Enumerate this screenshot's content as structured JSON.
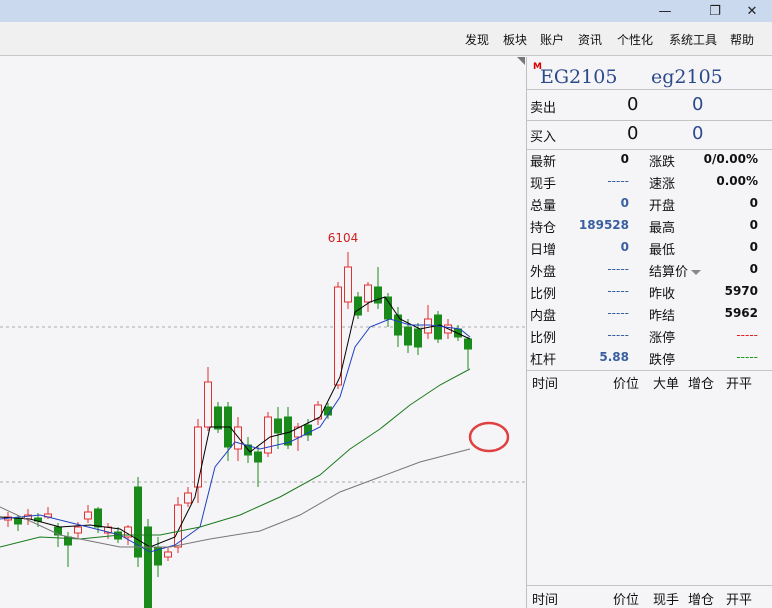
{
  "window": {
    "minimize_glyph": "—",
    "restore_glyph": "❐",
    "close_glyph": "✕"
  },
  "menu": [
    "发现",
    "板块",
    "账户",
    "资讯",
    "个性化",
    "系统工具",
    "帮助"
  ],
  "contract": {
    "badge": "M",
    "code_upper": "EG2105",
    "code_lower": "eg2105"
  },
  "orderbook": {
    "sell": {
      "label": "卖出",
      "price": "0",
      "volume": "0"
    },
    "buy": {
      "label": "买入",
      "price": "0",
      "volume": "0"
    }
  },
  "quote_left": [
    {
      "label": "最新",
      "value": "0",
      "style": "black"
    },
    {
      "label": "现手",
      "value": "-----",
      "style": "dash-blue"
    },
    {
      "label": "总量",
      "value": "0",
      "style": "blue"
    },
    {
      "label": "持仓",
      "value": "189528",
      "style": "blue"
    },
    {
      "label": "日增",
      "value": "0",
      "style": "blue"
    },
    {
      "label": "外盘",
      "value": "-----",
      "style": "dash-blue"
    },
    {
      "label": "比例",
      "value": "-----",
      "style": "dash-blue"
    },
    {
      "label": "内盘",
      "value": "-----",
      "style": "dash-blue"
    },
    {
      "label": "比例",
      "value": "-----",
      "style": "dash-blue"
    },
    {
      "label": "杠杆",
      "value": "5.88",
      "style": "blue"
    }
  ],
  "quote_right": [
    {
      "label": "涨跌",
      "value": "0/0.00%",
      "style": "black"
    },
    {
      "label": "速涨",
      "value": "0.00%",
      "style": "black"
    },
    {
      "label": "开盘",
      "value": "0",
      "style": "black"
    },
    {
      "label": "最高",
      "value": "0",
      "style": "black"
    },
    {
      "label": "最低",
      "value": "0",
      "style": "black"
    },
    {
      "label": "结算价",
      "value": "0",
      "style": "black"
    },
    {
      "label": "昨收",
      "value": "5970",
      "style": "black"
    },
    {
      "label": "昨结",
      "value": "5962",
      "style": "black"
    },
    {
      "label": "涨停",
      "value": "-----",
      "style": "dash-red"
    },
    {
      "label": "跌停",
      "value": "-----",
      "style": "dash-green"
    }
  ],
  "trade_table_headers": [
    "时间",
    "价位",
    "大单",
    "增仓",
    "开平"
  ],
  "tick_table_headers": [
    "时间",
    "价位",
    "现手",
    "增仓",
    "开平"
  ],
  "chart": {
    "peak_label": "6104",
    "colors": {
      "up": "#e03030",
      "down": "#1a8a1a",
      "ma5": "#000000",
      "ma10": "#2040c0",
      "ma20": "#1a7a1a",
      "ma60": "#777777",
      "peak_text": "#d02020",
      "marker": "#e04040"
    }
  }
}
